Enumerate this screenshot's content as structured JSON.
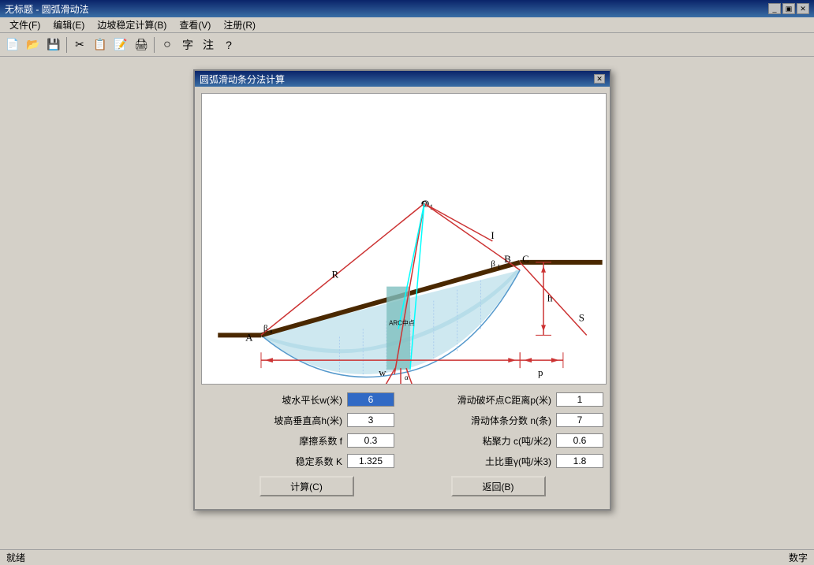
{
  "window": {
    "title": "无标题 - 圆弧滑动法"
  },
  "menubar": {
    "items": [
      "文件(F)",
      "编辑(E)",
      "边坡稳定计算(B)",
      "查看(V)",
      "注册(R)"
    ]
  },
  "toolbar": {
    "buttons": [
      "📄",
      "📂",
      "💾",
      "✂",
      "📋",
      "📝",
      "🖨",
      "○",
      "字",
      "注",
      "?"
    ]
  },
  "dialog": {
    "title": "圆弧滑动条分法计算",
    "fields": {
      "slope_w_label": "坡水平长w(米)",
      "slope_w_value": "6",
      "slope_h_label": "坡高垂直高h(米)",
      "slope_h_value": "3",
      "friction_label": "摩擦系数 f",
      "friction_value": "0.3",
      "stability_label": "稳定系数 K",
      "stability_value": "1.325",
      "c_dist_label": "滑动破坏点C距离p(米)",
      "c_dist_value": "1",
      "strips_label": "滑动体条分数 n(条)",
      "strips_value": "7",
      "cohesion_label": "粘聚力 c(吨/米2)",
      "cohesion_value": "0.6",
      "soil_weight_label": "土比重γ(吨/米3)",
      "soil_weight_value": "1.8"
    },
    "buttons": {
      "calculate": "计算(C)",
      "back": "返回(B)"
    }
  },
  "statusbar": {
    "left": "就绪",
    "right": "数字"
  }
}
